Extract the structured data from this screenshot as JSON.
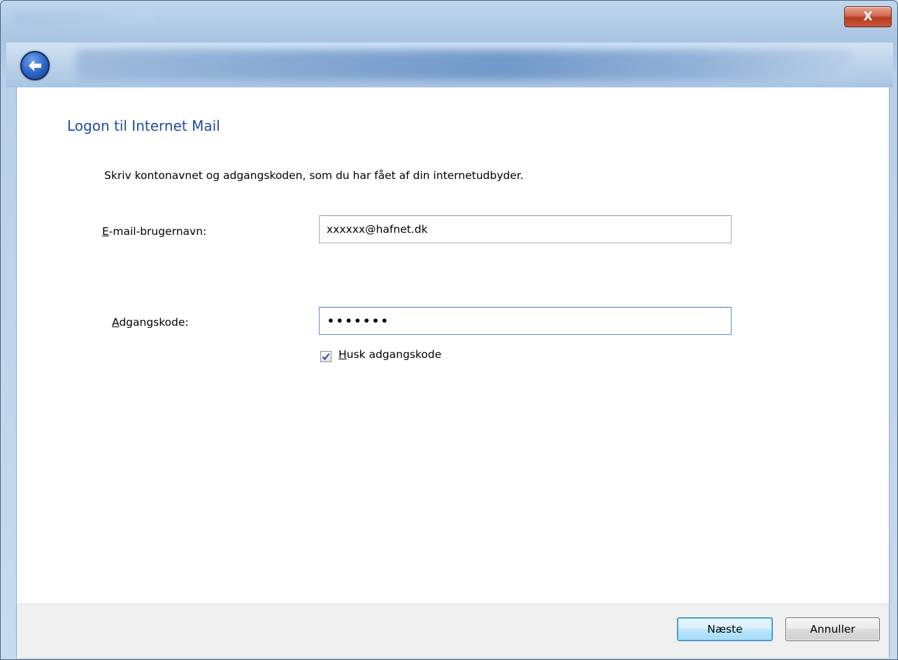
{
  "window": {
    "close_label": "X"
  },
  "page": {
    "heading": "Logon til Internet Mail",
    "intro": "Skriv kontonavnet og adgangskoden, som du har fået af din internetudbyder."
  },
  "form": {
    "email_label_accel": "E",
    "email_label_rest": "-mail-brugernavn:",
    "email_value": "xxxxxx@hafnet.dk",
    "password_label_accel": "A",
    "password_label_rest": "dgangskode:",
    "password_value": "•••••••",
    "remember_accel": "H",
    "remember_rest": "usk adgangskode",
    "remember_checked": true
  },
  "footer": {
    "next_label": "Næste",
    "cancel_label": "Annuller"
  },
  "colors": {
    "heading": "#1e4e9e",
    "default_button_border": "#3c7fb1"
  }
}
